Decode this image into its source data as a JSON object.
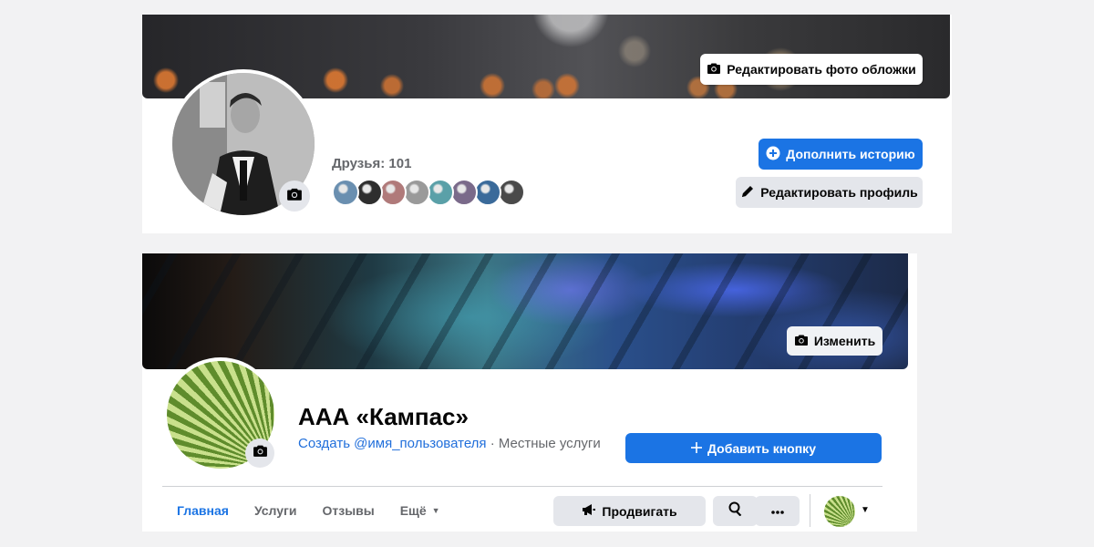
{
  "profile": {
    "edit_cover_label": "Редактировать фото обложки",
    "friends_label": "Друзья: 101",
    "friend_avatar_colors": [
      "#6a8fb0",
      "#2e2e2e",
      "#b07a7a",
      "#9a9a9a",
      "#5aa0a8",
      "#7a6a8a",
      "#3a6a9a",
      "#4a4a4a"
    ],
    "add_story_label": "Дополнить историю",
    "edit_profile_label": "Редактировать профиль"
  },
  "page": {
    "edit_cover_label": "Изменить",
    "title": "ААА «Кампас»",
    "username_link": "Создать @имя_пользователя",
    "separator": " · ",
    "category": "Местные услуги",
    "add_button_label": "Добавить кнопку",
    "tabs": [
      {
        "label": "Главная",
        "active": true
      },
      {
        "label": "Услуги",
        "active": false
      },
      {
        "label": "Отзывы",
        "active": false
      },
      {
        "label": "Ещё",
        "active": false,
        "dropdown": true
      }
    ],
    "promote_label": "Продвигать"
  },
  "colors": {
    "accent": "#1b74e4",
    "link": "#216fdb",
    "secondary_button": "#e4e6eb",
    "muted_text": "#65676b"
  },
  "icons": {
    "camera": "camera-icon",
    "plus_circle": "plus-circle-icon",
    "pencil": "pencil-icon",
    "plus": "plus-icon",
    "megaphone": "megaphone-icon",
    "search": "search-icon",
    "more": "more-icon",
    "caret": "caret-down-icon"
  }
}
